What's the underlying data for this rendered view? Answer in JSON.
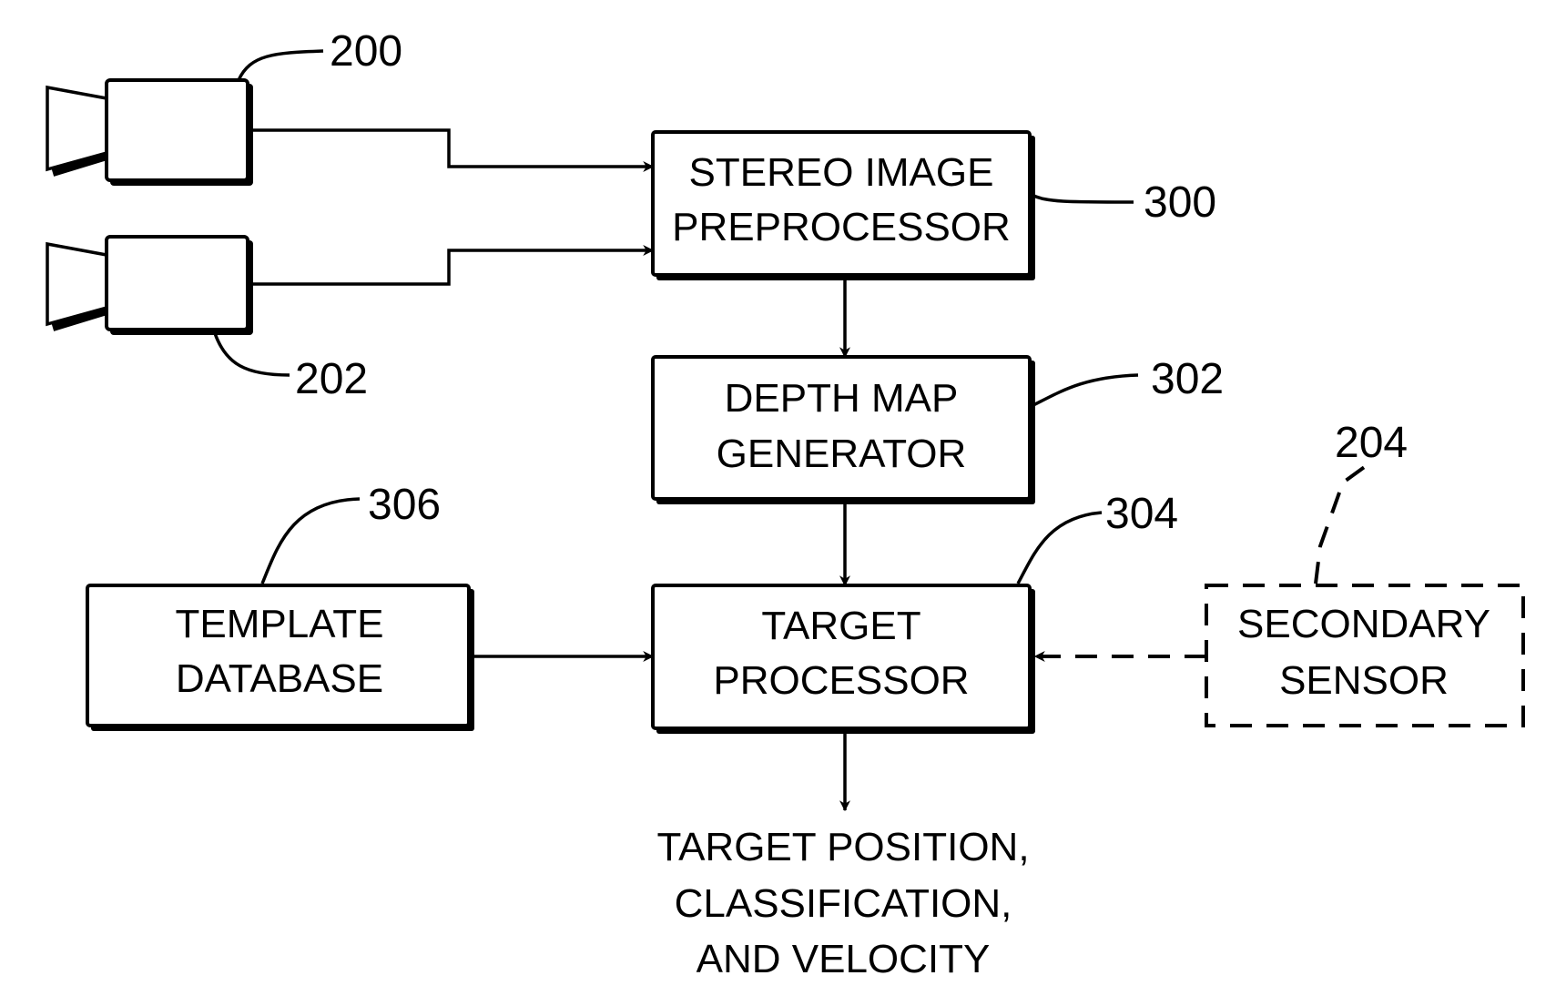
{
  "diagram": {
    "cameras": [
      {
        "ref": "200",
        "label": "camera"
      },
      {
        "ref": "202",
        "label": "camera"
      }
    ],
    "blocks": {
      "stereo": {
        "ref": "300",
        "lines": [
          "STEREO IMAGE",
          "PREPROCESSOR"
        ]
      },
      "depth": {
        "ref": "302",
        "lines": [
          "DEPTH MAP",
          "GENERATOR"
        ]
      },
      "target": {
        "ref": "304",
        "lines": [
          "TARGET",
          "PROCESSOR"
        ]
      },
      "template": {
        "ref": "306",
        "lines": [
          "TEMPLATE",
          "DATABASE"
        ]
      },
      "secondary": {
        "ref": "204",
        "lines": [
          "SECONDARY",
          "SENSOR"
        ],
        "style": "dashed"
      }
    },
    "output": {
      "lines": [
        "TARGET POSITION,",
        "CLASSIFICATION,",
        "AND VELOCITY"
      ]
    },
    "connections": [
      {
        "from": "camera-200",
        "to": "stereo"
      },
      {
        "from": "camera-202",
        "to": "stereo"
      },
      {
        "from": "stereo",
        "to": "depth"
      },
      {
        "from": "depth",
        "to": "target"
      },
      {
        "from": "template",
        "to": "target"
      },
      {
        "from": "secondary",
        "to": "target",
        "style": "dashed"
      },
      {
        "from": "target",
        "to": "output"
      }
    ]
  }
}
